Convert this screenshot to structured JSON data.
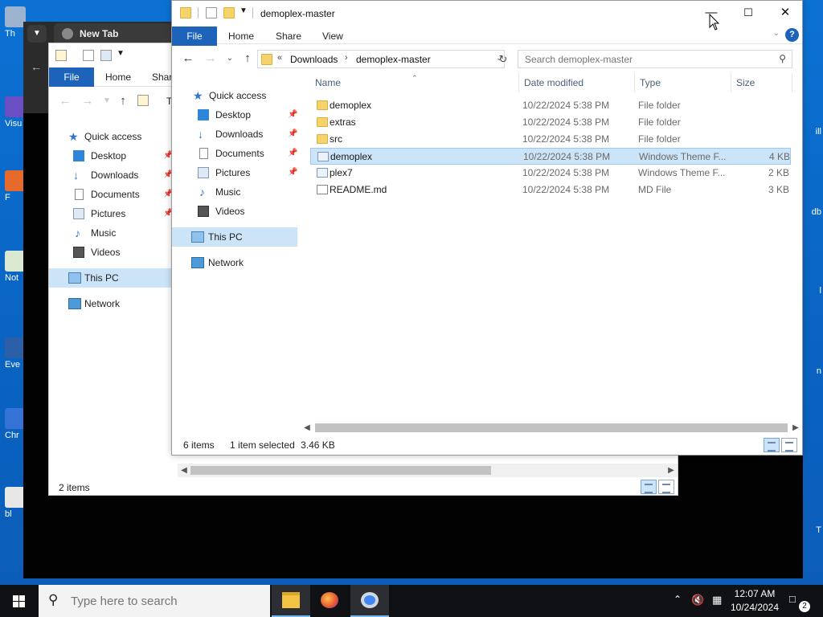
{
  "desktop": {
    "left_icons": [
      "Th",
      "Visu",
      "F",
      "Not",
      "Eve",
      "Chr",
      "bl"
    ],
    "right_labels": [
      "ill",
      "db",
      "l",
      "n",
      "T"
    ]
  },
  "chrome": {
    "tab_title": "New Tab"
  },
  "back_explorer": {
    "title_char": "T",
    "ribbon": {
      "file": "File",
      "home": "Home",
      "share": "Shar"
    },
    "nav": {
      "quick_access": "Quick access",
      "items": [
        {
          "label": "Desktop"
        },
        {
          "label": "Downloads"
        },
        {
          "label": "Documents"
        },
        {
          "label": "Pictures"
        },
        {
          "label": "Music"
        },
        {
          "label": "Videos"
        }
      ],
      "this_pc": "This PC",
      "network": "Network"
    },
    "status": "2 items"
  },
  "explorer": {
    "title": "demoplex-master",
    "ribbon": {
      "file": "File",
      "home": "Home",
      "share": "Share",
      "view": "View",
      "help": "?"
    },
    "address": {
      "prefix": "«",
      "crumbs": [
        "Downloads",
        "demoplex-master"
      ]
    },
    "search_placeholder": "Search demoplex-master",
    "nav": {
      "quick_access": "Quick access",
      "items": [
        {
          "label": "Desktop",
          "pinned": true
        },
        {
          "label": "Downloads",
          "pinned": true
        },
        {
          "label": "Documents",
          "pinned": true
        },
        {
          "label": "Pictures",
          "pinned": true
        },
        {
          "label": "Music",
          "pinned": false
        },
        {
          "label": "Videos",
          "pinned": false
        }
      ],
      "this_pc": "This PC",
      "network": "Network"
    },
    "columns": {
      "name": "Name",
      "date": "Date modified",
      "type": "Type",
      "size": "Size"
    },
    "files": [
      {
        "name": "demoplex",
        "date": "10/22/2024 5:38 PM",
        "type": "File folder",
        "size": "",
        "icon": "folder"
      },
      {
        "name": "extras",
        "date": "10/22/2024 5:38 PM",
        "type": "File folder",
        "size": "",
        "icon": "folder"
      },
      {
        "name": "src",
        "date": "10/22/2024 5:38 PM",
        "type": "File folder",
        "size": "",
        "icon": "folder"
      },
      {
        "name": "demoplex",
        "date": "10/22/2024 5:38 PM",
        "type": "Windows Theme F...",
        "size": "4 KB",
        "icon": "theme",
        "selected": true
      },
      {
        "name": "plex7",
        "date": "10/22/2024 5:38 PM",
        "type": "Windows Theme F...",
        "size": "2 KB",
        "icon": "theme"
      },
      {
        "name": "README.md",
        "date": "10/22/2024 5:38 PM",
        "type": "MD File",
        "size": "3 KB",
        "icon": "doc"
      }
    ],
    "status": {
      "count": "6 items",
      "selection": "1 item selected",
      "size": "3.46 KB"
    }
  },
  "taskbar": {
    "search_placeholder": "Type here to search",
    "time": "12:07 AM",
    "date": "10/24/2024",
    "notifications": "2"
  }
}
